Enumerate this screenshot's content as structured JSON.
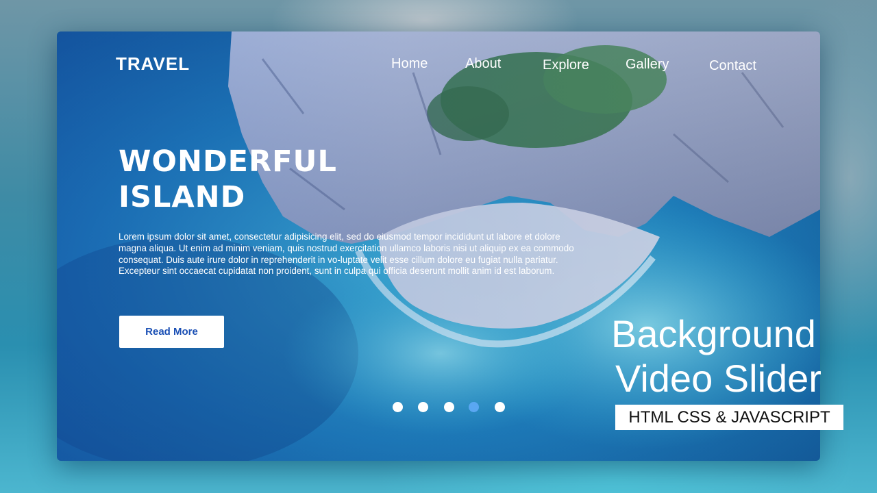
{
  "brand": {
    "logo": "TRAVEL"
  },
  "nav": {
    "items": [
      {
        "label": "Home"
      },
      {
        "label": "About"
      },
      {
        "label": "Explore"
      },
      {
        "label": "Gallery"
      },
      {
        "label": "Contact"
      }
    ]
  },
  "hero": {
    "headline_line1": "WONDERFUL",
    "headline_line2": "ISLAND",
    "body": "Lorem ipsum dolor sit amet, consectetur adipisicing elit, sed do eiusmod tempor incididunt ut labore et dolore magna aliqua. Ut enim ad minim veniam, quis nostrud exercitation ullamco laboris nisi ut aliquip ex ea commodo consequat. Duis aute irure dolor in reprehenderit in vo-luptate velit esse cillum dolore eu fugiat nulla pariatur. Excepteur sint occaecat cupidatat non proident, sunt in culpa qui officia deserunt mollit anim id est laborum.",
    "button_label": "Read More"
  },
  "slider": {
    "slide_count": 5,
    "active_index": 3
  },
  "overlay": {
    "title_line1": "Background",
    "title_line2": "Video Slider",
    "badge": "HTML CSS & JAVASCRIPT"
  },
  "colors": {
    "accent": "#1a4fb4",
    "active_dot": "#5aa7f2",
    "text": "#ffffff",
    "ocean": "#1f8fc2",
    "rocks": "#a9b4cc",
    "vegetation": "#3f7a4a",
    "sand": "#dcdde8"
  }
}
